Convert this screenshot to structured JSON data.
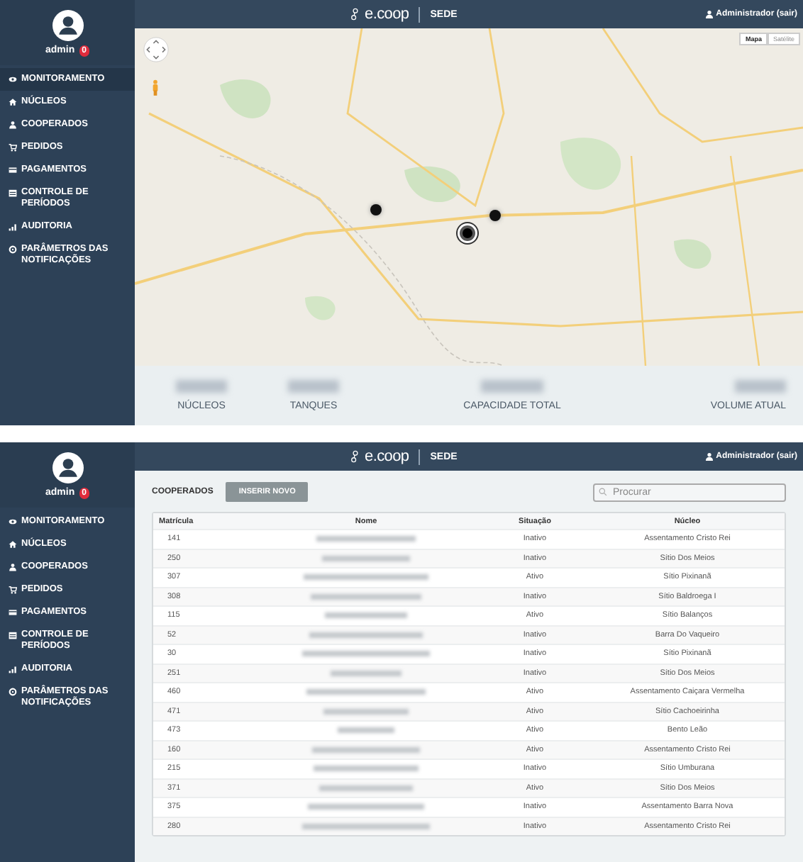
{
  "screens": [
    {
      "kind": "map",
      "header": {
        "logo": "e.coop",
        "section": "SEDE",
        "user": "Administrador (sair)"
      },
      "sidebar": {
        "user": "admin",
        "badge": "0",
        "items": [
          {
            "label": "MONITORAMENTO",
            "selected": true
          },
          {
            "label": "NÚCLEOS",
            "selected": false
          },
          {
            "label": "COOPERADOS",
            "selected": false
          },
          {
            "label": "PEDIDOS",
            "selected": false
          },
          {
            "label": "PAGAMENTOS",
            "selected": false
          },
          {
            "label": "CONTROLE DE PERÍODOS",
            "selected": false
          },
          {
            "label": "AUDITORIA",
            "selected": false
          },
          {
            "label": "PARÂMETROS DAS NOTIFICAÇÕES",
            "selected": false
          }
        ]
      },
      "map": {
        "kind": "picture",
        "map_types": [
          {
            "label": "Mapa",
            "selected": true
          },
          {
            "label": "Satélite",
            "selected": false
          }
        ]
      },
      "stats": [
        {
          "label": "NÚCLEOS"
        },
        {
          "label": "TANQUES"
        },
        {
          "label": "CAPACIDADE TOTAL"
        },
        {
          "label": "VOLUME ATUAL"
        }
      ]
    },
    {
      "kind": "list",
      "header": {
        "logo": "e.coop",
        "section": "SEDE",
        "user": "Administrador (sair)"
      },
      "sidebar": {
        "user": "admin",
        "badge": "0",
        "items": [
          {
            "label": "MONITORAMENTO",
            "selected": false
          },
          {
            "label": "NÚCLEOS",
            "selected": false
          },
          {
            "label": "COOPERADOS",
            "selected": false
          },
          {
            "label": "PEDIDOS",
            "selected": false
          },
          {
            "label": "PAGAMENTOS",
            "selected": false
          },
          {
            "label": "CONTROLE DE PERÍODOS",
            "selected": false
          },
          {
            "label": "AUDITORIA",
            "selected": false
          },
          {
            "label": "PARÂMETROS DAS NOTIFICAÇÕES",
            "selected": false
          }
        ]
      },
      "title": "COOPERADOS",
      "button": "INSERIR NOVO",
      "search": {
        "placeholder": "Procurar"
      },
      "table": {
        "columns": [
          "Matrícula",
          "Nome",
          "Situação",
          "Núcleo"
        ],
        "rows": [
          [
            "141",
            "",
            "Inativo",
            "Assentamento Cristo Rei"
          ],
          [
            "250",
            "",
            "Inativo",
            "Sítio Dos Meios"
          ],
          [
            "307",
            "",
            "Ativo",
            "Sítio Pixinanã"
          ],
          [
            "308",
            "",
            "Inativo",
            "Sítio Baldroega I"
          ],
          [
            "115",
            "",
            "Ativo",
            "Sítio Balanços"
          ],
          [
            "52",
            "",
            "Inativo",
            "Barra Do Vaqueiro"
          ],
          [
            "30",
            "",
            "Inativo",
            "Sítio Pixinanã"
          ],
          [
            "251",
            "",
            "Inativo",
            "Sítio Dos Meios"
          ],
          [
            "460",
            "",
            "Ativo",
            "Assentamento Caiçara Vermelha"
          ],
          [
            "471",
            "",
            "Ativo",
            "Sítio Cachoeirinha"
          ],
          [
            "473",
            "",
            "Ativo",
            "Bento Leão"
          ],
          [
            "160",
            "",
            "Ativo",
            "Assentamento Cristo Rei"
          ],
          [
            "215",
            "",
            "Inativo",
            "Sítio Umburana"
          ],
          [
            "371",
            "",
            "Ativo",
            "Sítio Dos Meios"
          ],
          [
            "375",
            "",
            "Inativo",
            "Assentamento Barra Nova"
          ],
          [
            "280",
            "",
            "Inativo",
            "Assentamento Cristo Rei"
          ]
        ]
      }
    }
  ]
}
